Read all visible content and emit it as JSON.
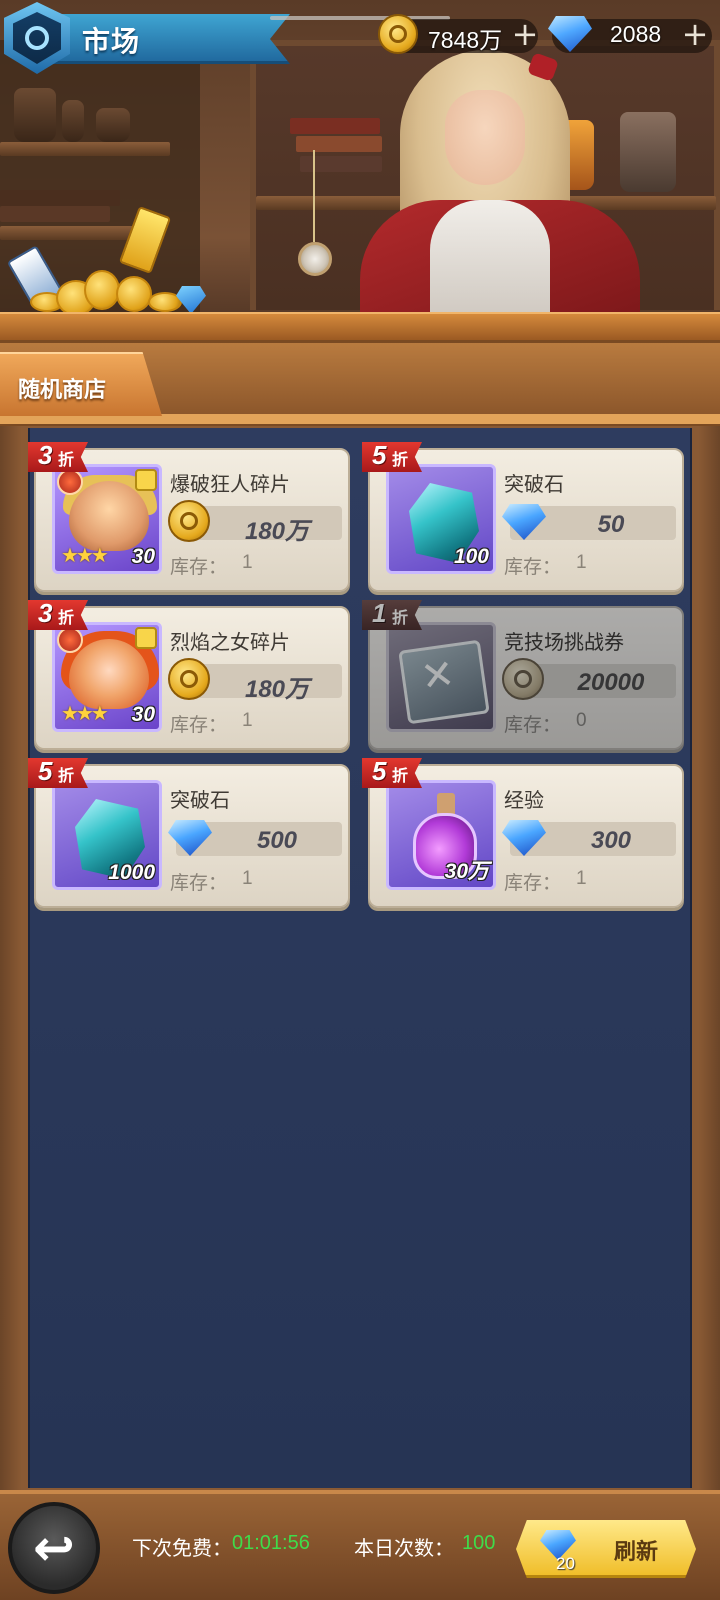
{
  "header": {
    "title": "市场",
    "gold": "7848万",
    "gems": "2088",
    "plus": "+"
  },
  "tabs": [
    {
      "label": "随机商店",
      "active": true
    }
  ],
  "items": [
    {
      "name": "爆破狂人碎片",
      "discount": "3",
      "discount_unit": "折",
      "qty": "30",
      "currency": "coin-icon",
      "price": "180万",
      "stock_label": "库存：",
      "stock": "1",
      "stars": "★★★",
      "sold_out": false
    },
    {
      "name": "突破石",
      "discount": "5",
      "discount_unit": "折",
      "qty": "100",
      "currency": "gem-icon",
      "price": "50",
      "stock_label": "库存：",
      "stock": "1",
      "sold_out": false
    },
    {
      "name": "烈焰之女碎片",
      "discount": "3",
      "discount_unit": "折",
      "qty": "30",
      "currency": "coin-icon",
      "price": "180万",
      "stock_label": "库存：",
      "stock": "1",
      "stars": "★★★",
      "sold_out": false
    },
    {
      "name": "竞技场挑战券",
      "discount": "1",
      "discount_unit": "折",
      "qty": "",
      "currency": "coin-icon",
      "price": "20000",
      "stock_label": "库存：",
      "stock": "0",
      "sold_out": true
    },
    {
      "name": "突破石",
      "discount": "5",
      "discount_unit": "折",
      "qty": "1000",
      "currency": "gem-icon",
      "price": "500",
      "stock_label": "库存：",
      "stock": "1",
      "sold_out": false
    },
    {
      "name": "经验",
      "discount": "5",
      "discount_unit": "折",
      "qty": "30万",
      "currency": "gem-icon",
      "price": "300",
      "stock_label": "库存：",
      "stock": "1",
      "sold_out": false
    }
  ],
  "footer": {
    "free_label": "下次免费：",
    "free_time": "01:01:56",
    "count_label": "本日次数：",
    "count_value": "100",
    "refresh_cost": "20",
    "refresh_label": "刷新",
    "back_glyph": "↩"
  }
}
